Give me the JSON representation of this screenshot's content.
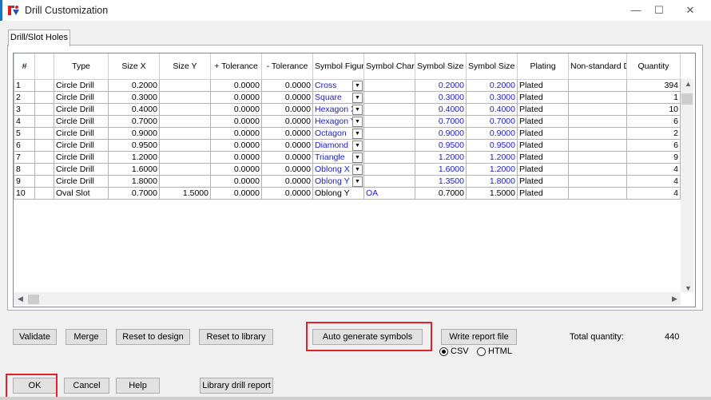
{
  "window": {
    "title": "Drill Customization",
    "minimize": "—",
    "maximize": "☐",
    "close": "✕"
  },
  "tabs": [
    {
      "label": "Drill/Slot Holes"
    }
  ],
  "table": {
    "headers": [
      "#",
      "",
      "Type",
      "Size X",
      "Size Y",
      "+ Tolerance",
      "- Tolerance",
      "Symbol Figure",
      "Symbol Characters",
      "Symbol Size X",
      "Symbol Size Y",
      "Plating",
      "Non-standard Drill",
      "Quantity"
    ],
    "rows": [
      [
        "1",
        "",
        "Circle Drill",
        "0.2000",
        "",
        "0.0000",
        "0.0000",
        "Cross",
        "",
        "0.2000",
        "0.2000",
        "Plated",
        "",
        "394"
      ],
      [
        "2",
        "",
        "Circle Drill",
        "0.3000",
        "",
        "0.0000",
        "0.0000",
        "Square",
        "",
        "0.3000",
        "0.3000",
        "Plated",
        "",
        "1"
      ],
      [
        "3",
        "",
        "Circle Drill",
        "0.4000",
        "",
        "0.0000",
        "0.0000",
        "Hexagon X",
        "",
        "0.4000",
        "0.4000",
        "Plated",
        "",
        "10"
      ],
      [
        "4",
        "",
        "Circle Drill",
        "0.7000",
        "",
        "0.0000",
        "0.0000",
        "Hexagon Y",
        "",
        "0.7000",
        "0.7000",
        "Plated",
        "",
        "6"
      ],
      [
        "5",
        "",
        "Circle Drill",
        "0.9000",
        "",
        "0.0000",
        "0.0000",
        "Octagon",
        "",
        "0.9000",
        "0.9000",
        "Plated",
        "",
        "2"
      ],
      [
        "6",
        "",
        "Circle Drill",
        "0.9500",
        "",
        "0.0000",
        "0.0000",
        "Diamond",
        "",
        "0.9500",
        "0.9500",
        "Plated",
        "",
        "6"
      ],
      [
        "7",
        "",
        "Circle Drill",
        "1.2000",
        "",
        "0.0000",
        "0.0000",
        "Triangle",
        "",
        "1.2000",
        "1.2000",
        "Plated",
        "",
        "9"
      ],
      [
        "8",
        "",
        "Circle Drill",
        "1.6000",
        "",
        "0.0000",
        "0.0000",
        "Oblong X",
        "",
        "1.6000",
        "1.2000",
        "Plated",
        "",
        "4"
      ],
      [
        "9",
        "",
        "Circle Drill",
        "1.8000",
        "",
        "0.0000",
        "0.0000",
        "Oblong Y",
        "",
        "1.3500",
        "1.8000",
        "Plated",
        "",
        "4"
      ],
      [
        "10",
        "",
        "Oval Slot",
        "0.7000",
        "1.5000",
        "0.0000",
        "0.0000",
        "Oblong Y",
        "OA",
        "0.7000",
        "1.5000",
        "Plated",
        "",
        "4"
      ]
    ]
  },
  "buttons": {
    "validate": "Validate",
    "merge": "Merge",
    "reset_design": "Reset to design",
    "reset_library": "Reset to library",
    "auto_generate": "Auto generate symbols",
    "write_report": "Write report file",
    "ok": "OK",
    "cancel": "Cancel",
    "help": "Help",
    "library_report": "Library drill report"
  },
  "report_format": {
    "csv": "CSV",
    "html": "HTML",
    "selected": "CSV"
  },
  "total": {
    "label": "Total quantity:",
    "value": "440"
  },
  "colors": {
    "accent_blue": "#1a1acd",
    "highlight_red": "#e0202a",
    "app_icon_red": "#d42020"
  }
}
